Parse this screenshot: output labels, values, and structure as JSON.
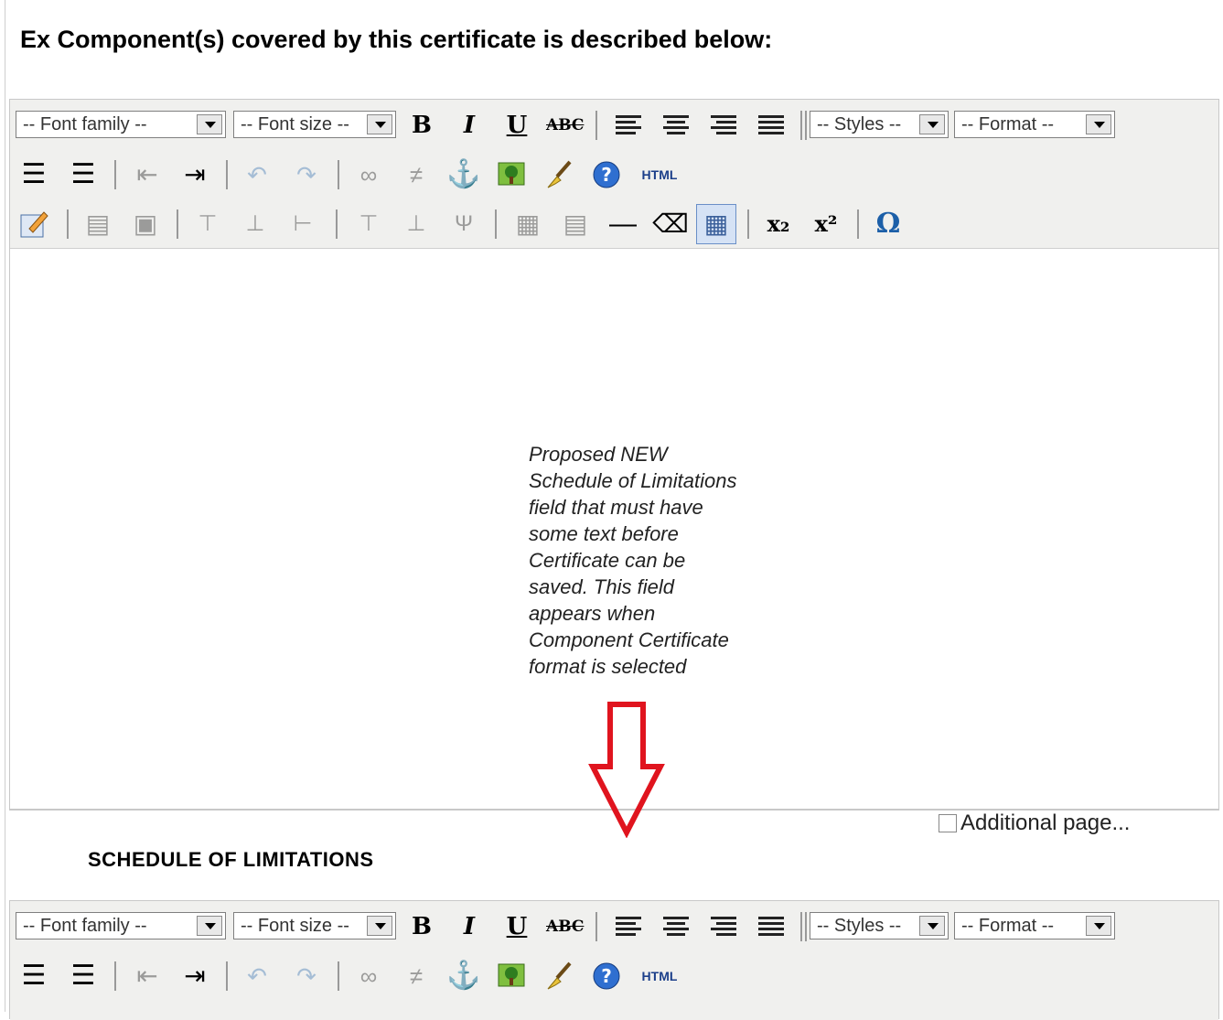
{
  "heading": "Ex Component(s) covered by this certificate is described below:",
  "toolbar": {
    "font_family": "-- Font family --",
    "font_size": "-- Font size --",
    "styles": "-- Styles --",
    "format": "-- Format --",
    "bold": "B",
    "italic": "I",
    "underline": "U",
    "strike": "ABC",
    "html": "HTML",
    "subscript": "x₂",
    "superscript": "x²",
    "omega": "Ω"
  },
  "note": "Proposed NEW\nSchedule of Limitations\nfield that must have\nsome text before\nCertificate can be\nsaved.  This field\nappears when\nComponent Certificate\nformat is selected",
  "additional_page": "Additional page...",
  "schedule_title": "SCHEDULE OF LIMITATIONS",
  "colors": {
    "arrow": "#e0141e",
    "toolbar_bg": "#f0f0ee",
    "link_blue": "#1c5fa8"
  }
}
